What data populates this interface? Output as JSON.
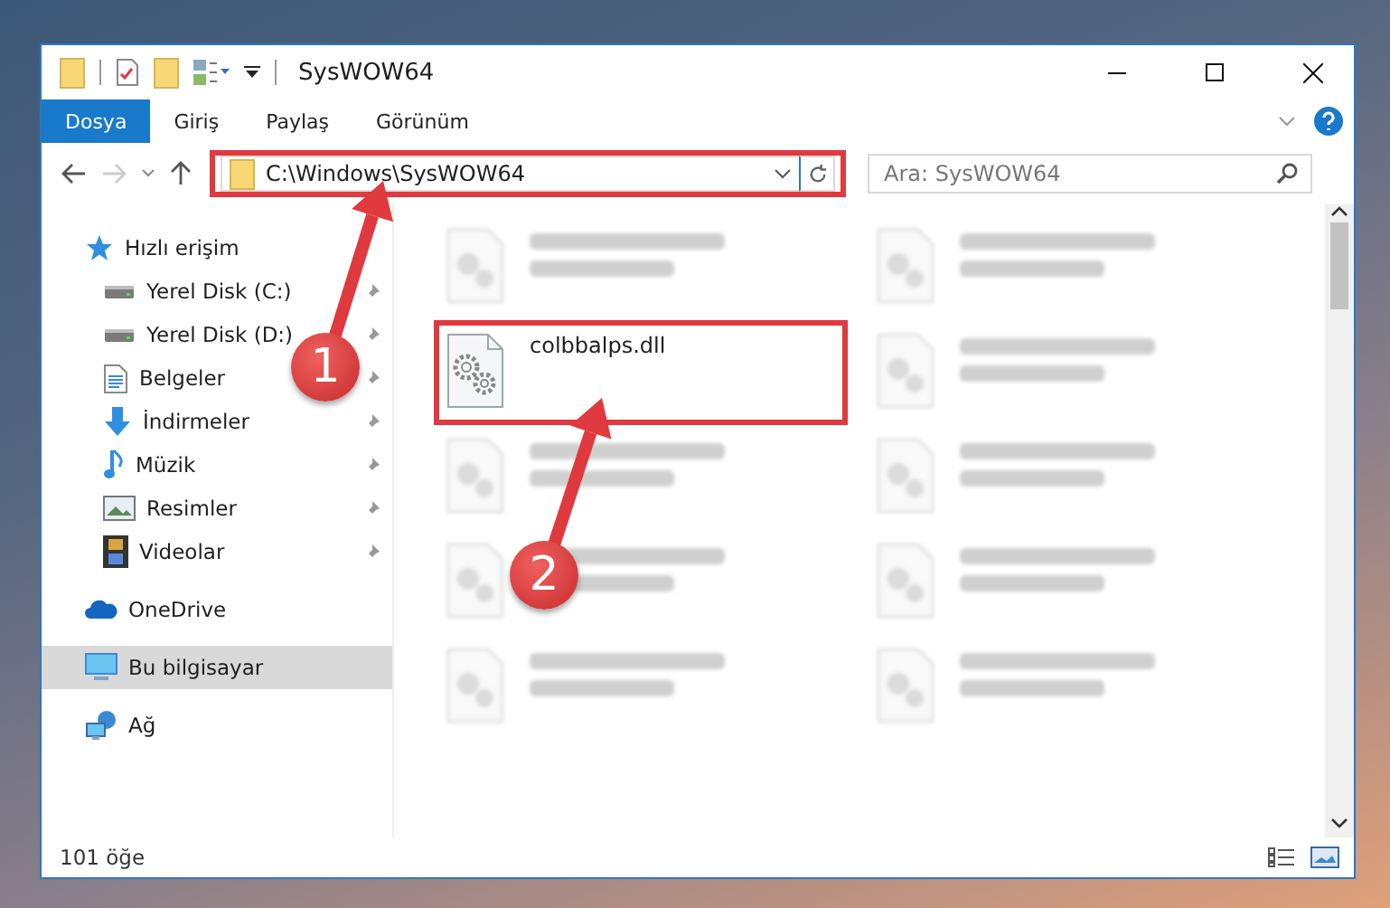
{
  "window": {
    "title": "SysWOW64"
  },
  "ribbon": {
    "tabs": [
      {
        "label": "Dosya",
        "selected": true
      },
      {
        "label": "Giriş",
        "selected": false
      },
      {
        "label": "Paylaş",
        "selected": false
      },
      {
        "label": "Görünüm",
        "selected": false
      }
    ]
  },
  "address": {
    "path": "C:\\Windows\\SysWOW64",
    "highlighted": true
  },
  "search": {
    "placeholder": "Ara: SysWOW64"
  },
  "sidebar": {
    "items": [
      {
        "label": "Hızlı erişim",
        "kind": "star",
        "selected": false,
        "children": [
          {
            "label": "Yerel Disk (C:)",
            "kind": "drive",
            "pinned": true,
            "selected": false
          },
          {
            "label": "Yerel Disk (D:)",
            "kind": "drive",
            "pinned": true,
            "selected": false
          },
          {
            "label": "Belgeler",
            "kind": "documents",
            "pinned": true,
            "selected": false
          },
          {
            "label": "İndirmeler",
            "kind": "download",
            "pinned": true,
            "selected": false
          },
          {
            "label": "Müzik",
            "kind": "music",
            "pinned": true,
            "selected": false
          },
          {
            "label": "Resimler",
            "kind": "pictures",
            "pinned": true,
            "selected": false
          },
          {
            "label": "Videolar",
            "kind": "video",
            "pinned": true,
            "selected": false
          }
        ]
      },
      {
        "label": "OneDrive",
        "kind": "cloud",
        "selected": false
      },
      {
        "label": "Bu bilgisayar",
        "kind": "computer",
        "selected": true
      },
      {
        "label": "Ağ",
        "kind": "network",
        "selected": false
      }
    ]
  },
  "files": [
    {
      "blurred": true
    },
    {
      "blurred": true
    },
    {
      "name": "colbbalps.dll",
      "blurred": false,
      "highlighted": true
    },
    {
      "blurred": true
    },
    {
      "blurred": true
    },
    {
      "blurred": true
    },
    {
      "blurred": true
    },
    {
      "blurred": true
    },
    {
      "blurred": true
    },
    {
      "blurred": true
    }
  ],
  "status_bar": {
    "item_count": "101 öğe"
  },
  "annotations": [
    {
      "label": "1"
    },
    {
      "label": "2"
    }
  ]
}
